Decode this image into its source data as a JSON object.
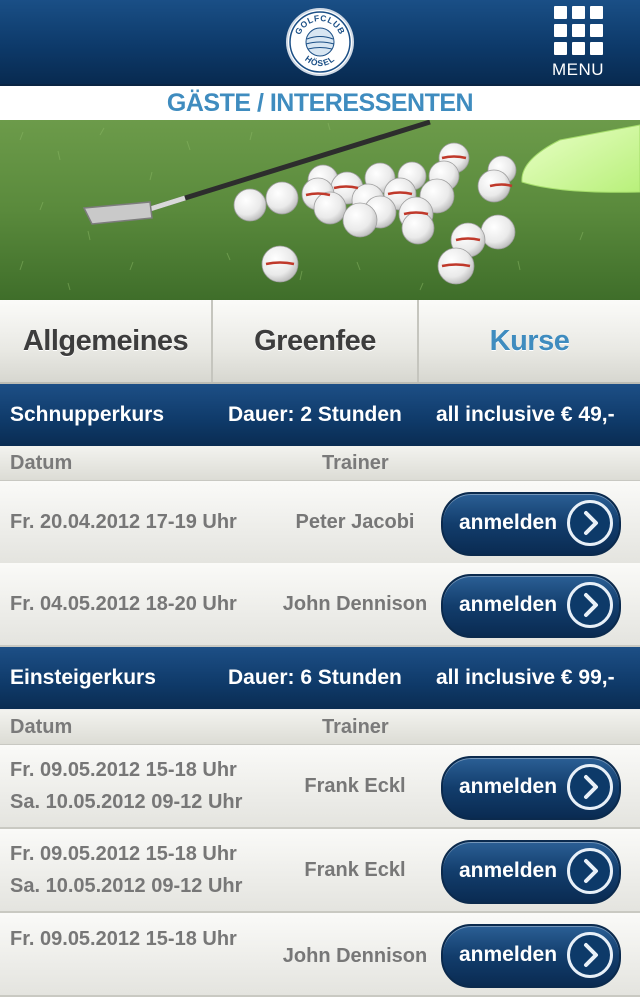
{
  "header": {
    "logo_top": "GOLFCLUB",
    "logo_bottom": "HÖSEL",
    "menu_label": "MENU"
  },
  "page": {
    "title": "GÄSTE / INTERESSENTEN"
  },
  "tabs": [
    {
      "label": "Allgemeines",
      "active": false
    },
    {
      "label": "Greenfee",
      "active": false
    },
    {
      "label": "Kurse",
      "active": true
    }
  ],
  "columns": {
    "date": "Datum",
    "trainer": "Trainer"
  },
  "courses": [
    {
      "name": "Schnupperkurs",
      "duration": "Dauer: 2 Stunden",
      "price": "all inclusive € 49,-",
      "sessions": [
        {
          "date_lines": [
            "Fr. 20.04.2012 17-19 Uhr"
          ],
          "trainer": "Peter Jacobi",
          "button": "anmelden"
        },
        {
          "date_lines": [
            "Fr. 04.05.2012 18-20 Uhr"
          ],
          "trainer": "John Dennison",
          "button": "anmelden"
        }
      ]
    },
    {
      "name": "Einsteigerkurs",
      "duration": "Dauer: 6 Stunden",
      "price": "all inclusive € 99,-",
      "sessions": [
        {
          "date_lines": [
            "Fr. 09.05.2012 15-18 Uhr",
            "Sa. 10.05.2012 09-12 Uhr"
          ],
          "trainer": "Frank Eckl",
          "button": "anmelden"
        },
        {
          "date_lines": [
            "Fr. 09.05.2012 15-18 Uhr",
            "Sa. 10.05.2012 09-12 Uhr"
          ],
          "trainer": "Frank Eckl",
          "button": "anmelden"
        },
        {
          "date_lines": [
            "Fr. 09.05.2012 15-18 Uhr"
          ],
          "trainer": "John Dennison",
          "button": "anmelden"
        }
      ]
    }
  ],
  "colors": {
    "brand_navy": "#0d3a6a",
    "accent_blue": "#3f8cbf"
  },
  "icons": {
    "logo": "golfclub-logo-icon",
    "menu": "grid-menu-icon",
    "signup_arrow": "chevron-right-circle-icon"
  }
}
